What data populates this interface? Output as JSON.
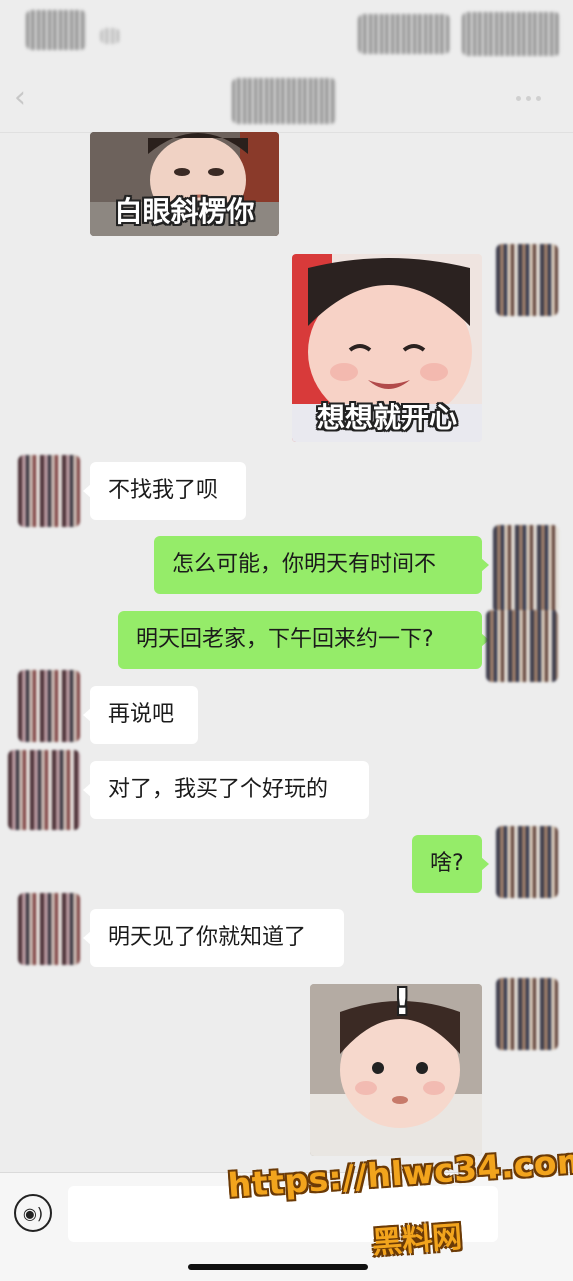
{
  "messages": [
    {
      "side": "left",
      "type": "sticker",
      "caption": "白眼斜楞你"
    },
    {
      "side": "right",
      "type": "sticker",
      "caption": "想想就开心"
    },
    {
      "side": "left",
      "type": "text",
      "text": "不找我了呗"
    },
    {
      "side": "right",
      "type": "text",
      "text": "怎么可能，你明天有时间不"
    },
    {
      "side": "right",
      "type": "text",
      "text": "明天回老家，下午回来约一下?"
    },
    {
      "side": "left",
      "type": "text",
      "text": "再说吧"
    },
    {
      "side": "left",
      "type": "text",
      "text": "对了，我买了个好玩的"
    },
    {
      "side": "right",
      "type": "text",
      "text": "啥?"
    },
    {
      "side": "left",
      "type": "text",
      "text": "明天见了你就知道了"
    },
    {
      "side": "right",
      "type": "sticker",
      "caption": "!"
    }
  ],
  "input_bar": {
    "voice_icon": "voice-icon",
    "placeholder": ""
  },
  "watermark": {
    "url": "https://hlwc34.com",
    "text": "黑料网"
  },
  "colors": {
    "background": "#ededed",
    "bubble_right": "#95ec69",
    "bubble_left": "#ffffff",
    "watermark": "#f2a41d"
  }
}
